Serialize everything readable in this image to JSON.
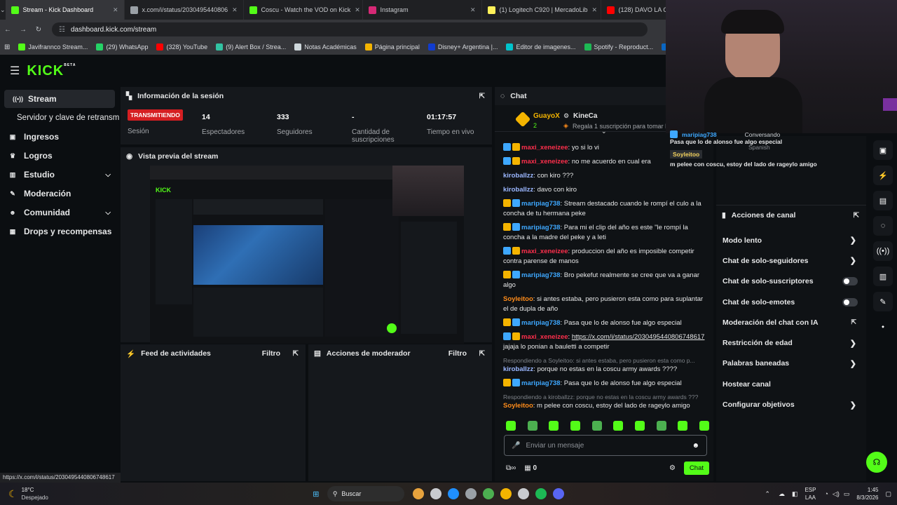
{
  "browser": {
    "tabs": [
      {
        "title": "Stream - Kick Dashboard",
        "color": "#53fc18"
      },
      {
        "title": "x.com/i/status/2030495440806",
        "color": "#9aa0a6"
      },
      {
        "title": "Coscu - Watch the VOD on Kick",
        "color": "#53fc18"
      },
      {
        "title": "Instagram",
        "color": "#d62976"
      },
      {
        "title": "(1) Logitech C920 | MercadoLib",
        "color": "#fff159"
      },
      {
        "title": "(128) DAVO LA COBRA MESSI",
        "color": "#ff0000"
      }
    ],
    "url": "dashboard.kick.com/stream",
    "bookmarks": [
      {
        "label": "Javifrannco Stream...",
        "color": "#53fc18"
      },
      {
        "label": "(29) WhatsApp",
        "color": "#25d366"
      },
      {
        "label": "(328) YouTube",
        "color": "#ff0000"
      },
      {
        "label": "(9) Alert Box / Strea...",
        "color": "#31c3a2"
      },
      {
        "label": "Notas Académicas",
        "color": "#cfd8dc"
      },
      {
        "label": "Página principal",
        "color": "#f4b400"
      },
      {
        "label": "Disney+ Argentina |...",
        "color": "#113ccf"
      },
      {
        "label": "Editor de imagenes...",
        "color": "#00c4cc"
      },
      {
        "label": "Spotify - Reproduct...",
        "color": "#1db954"
      },
      {
        "label": "Javier Franco | Li",
        "color": "#0a66c2"
      }
    ]
  },
  "kick": {
    "logo": "KICK",
    "beta": "BETA"
  },
  "sidebar": {
    "items": [
      {
        "label": "Stream",
        "icon": "broadcast-icon",
        "active": true
      },
      {
        "label": "Servidor y clave de retransm",
        "sub": true
      },
      {
        "label": "Ingresos",
        "icon": "wallet-icon"
      },
      {
        "label": "Logros",
        "icon": "trophy-icon"
      },
      {
        "label": "Estudio",
        "icon": "studio-icon",
        "chevron": true
      },
      {
        "label": "Moderación",
        "icon": "wrench-icon"
      },
      {
        "label": "Comunidad",
        "icon": "people-icon",
        "chevron": true
      },
      {
        "label": "Drops y recompensas",
        "icon": "gift-icon"
      }
    ]
  },
  "session": {
    "title": "Información de la sesión",
    "live": "TRANSMITIENDO",
    "live_label": "Sesión",
    "stats": [
      {
        "value": "14",
        "label": "Espectadores"
      },
      {
        "value": "333",
        "label": "Seguidores"
      },
      {
        "value": "-",
        "label": "Cantidad de suscripciones"
      },
      {
        "value": "01:17:57",
        "label": "Tiempo en vivo"
      }
    ]
  },
  "preview": {
    "title": "Vista previa del stream"
  },
  "feed": {
    "title": "Feed de actividades",
    "filter": "Filtro"
  },
  "modactions": {
    "title": "Acciones de moderador",
    "filter": "Filtro"
  },
  "chat": {
    "title": "Chat",
    "pinned": {
      "user": "GuayoX",
      "count": "2",
      "user2": "KineCa",
      "text": "Regala 1 suscripción para tomar la"
    },
    "messages": [
      {
        "user": "maxi_xeneizee",
        "color": "#ff2f4c",
        "text": "yo si lo vi"
      },
      {
        "user": "maxi_xeneizee",
        "color": "#ff2f4c",
        "text": "no me acuerdo en cual era"
      },
      {
        "user": "kiroballzz",
        "color": "#9bb7ff",
        "text": "con kiro ???"
      },
      {
        "user": "kiroballzz",
        "color": "#9bb7ff",
        "text": "davo con kiro"
      },
      {
        "user": "maripiag738",
        "color": "#3ea8ff",
        "text": "Stream destacado cuando le rompí el culo a la concha de tu hermana peke"
      },
      {
        "user": "maripiag738",
        "color": "#3ea8ff",
        "text": "Para mi el clip del año es este \"le rompí la concha a la madre del peke y a leti"
      },
      {
        "user": "maxi_xeneizee",
        "color": "#ff2f4c",
        "text": "produccion del año es imposible competir contra parense de manos"
      },
      {
        "user": "maripiag738",
        "color": "#3ea8ff",
        "text": "Bro pekefut realmente se cree que va a ganar algo"
      },
      {
        "user": "Soyleitoo",
        "color": "#ff8c1a",
        "text": "si antes estaba, pero pusieron esta como para suplantar el de dupla de año"
      },
      {
        "user": "maripiag738",
        "color": "#3ea8ff",
        "text": "Pasa que lo de alonso fue algo especial"
      },
      {
        "user": "maxi_xeneizee",
        "color": "#ff2f4c",
        "link": "https://x.com/i/status/2030495440806748617",
        "text": "jajaja lo ponian a bauletti a competir"
      },
      {
        "reply": "Respondiendo a Soyleitoo: si antes estaba, pero pusieron esta como p...",
        "user": "kiroballzz",
        "color": "#9bb7ff",
        "text": "porque no estas en la coscu army awards ????"
      },
      {
        "user": "maripiag738",
        "color": "#3ea8ff",
        "text": "Pasa que lo de alonso fue algo especial"
      },
      {
        "reply": "Respondiendo a kiroballzz: porque no estas en la coscu army awards ???",
        "user": "Soyleitoo",
        "color": "#ff8c1a",
        "text": "m pelee con coscu, estoy del lado de rageylo amigo"
      }
    ],
    "input_placeholder": "Enviar un mensaje",
    "points": "0",
    "send": "Chat"
  },
  "overlay": {
    "user1": "maripiag738",
    "msg1": "Pasa que lo de alonso fue algo especial",
    "status": "Conversando",
    "lang": "Spanish",
    "user2": "Soyleitoo",
    "msg2": "m pelee con coscu, estoy del lado de rageylo amigo"
  },
  "channel": {
    "title": "Acciones de canal",
    "items": [
      {
        "label": "Modo lento",
        "kind": "chevron"
      },
      {
        "label": "Chat de solo-seguidores",
        "kind": "chevron"
      },
      {
        "label": "Chat de solo-suscriptores",
        "kind": "toggle"
      },
      {
        "label": "Chat de solo-emotes",
        "kind": "toggle"
      },
      {
        "label": "Moderación del chat con IA",
        "kind": "popout"
      },
      {
        "label": "Restricción de edad",
        "kind": "chevron"
      },
      {
        "label": "Palabras baneadas",
        "kind": "chevron"
      },
      {
        "label": "Hostear canal",
        "kind": "none"
      },
      {
        "label": "Configurar objetivos",
        "kind": "chevron"
      }
    ]
  },
  "statusurl": "https://x.com/i/status/2030495440806748617",
  "taskbar": {
    "temp": "18°C",
    "weather": "Despejado",
    "search": "Buscar",
    "lang1": "ESP",
    "lang2": "LAA",
    "time": "1:45",
    "date": "8/3/2026"
  }
}
